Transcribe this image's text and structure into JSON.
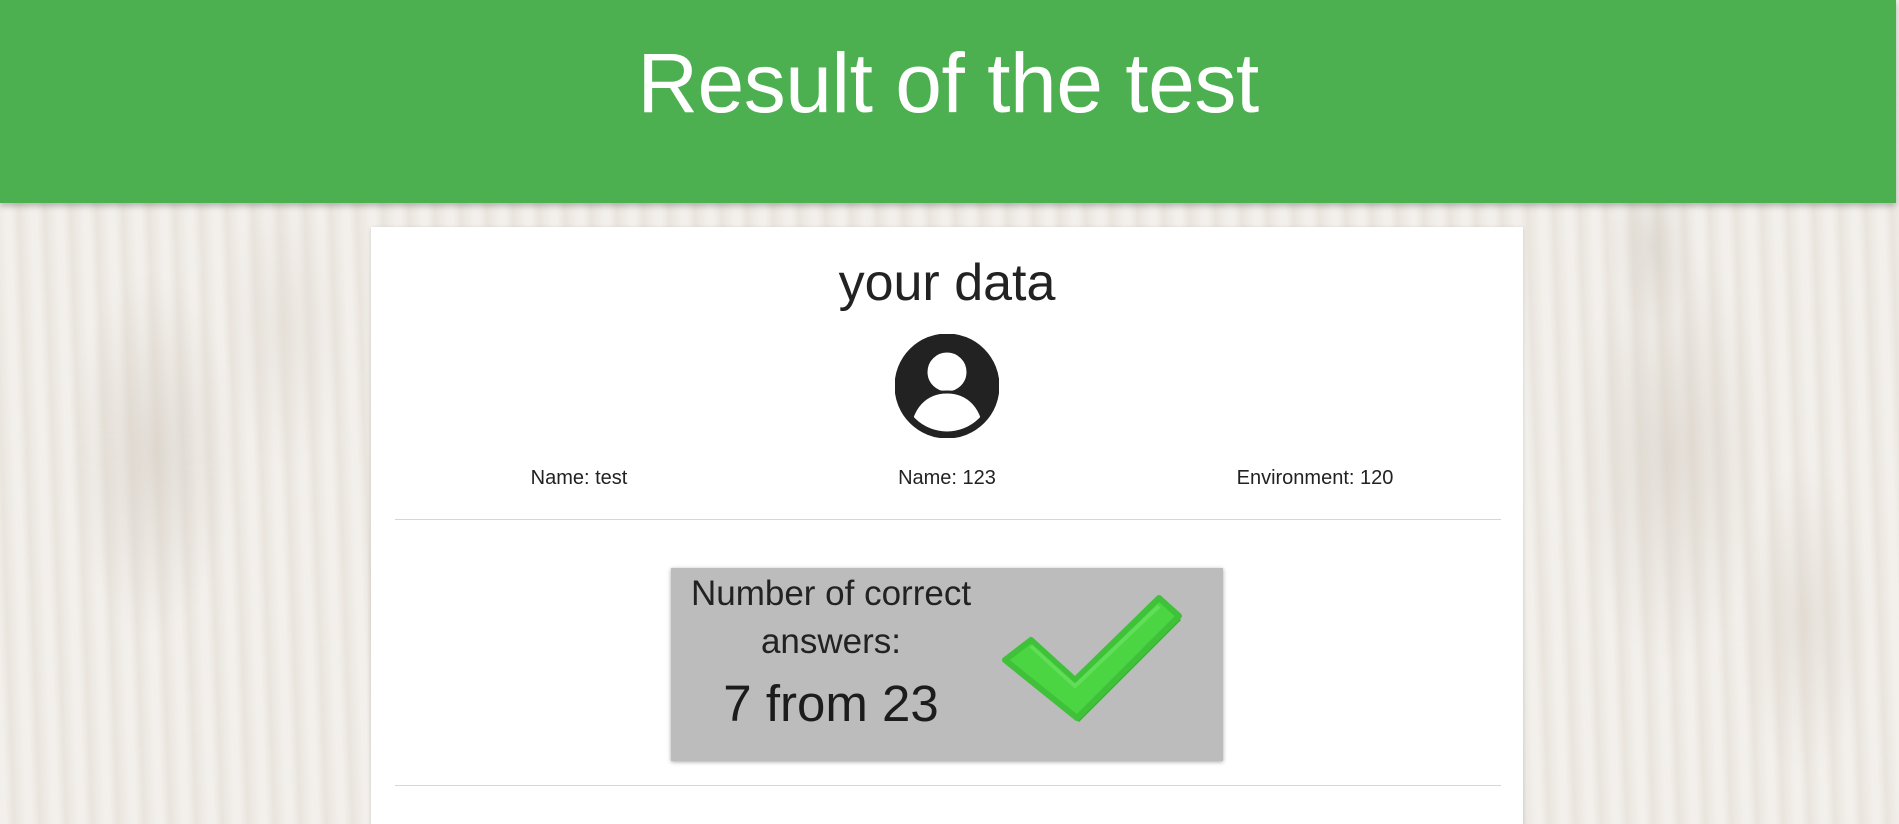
{
  "header": {
    "title": "Result of the test"
  },
  "card": {
    "section_title": "your data",
    "user_icon": "user-avatar-icon",
    "info": [
      {
        "label": "Name: test"
      },
      {
        "label": "Name: 123"
      },
      {
        "label": "Environment: 120"
      }
    ],
    "score": {
      "label": "Number of correct answers:",
      "value": "7 from 23",
      "icon": "checkmark-icon",
      "icon_color": "#4cd543"
    }
  },
  "colors": {
    "header_bg": "#4caf50",
    "header_text": "#ffffff",
    "score_box_bg": "#bcbcbc"
  }
}
